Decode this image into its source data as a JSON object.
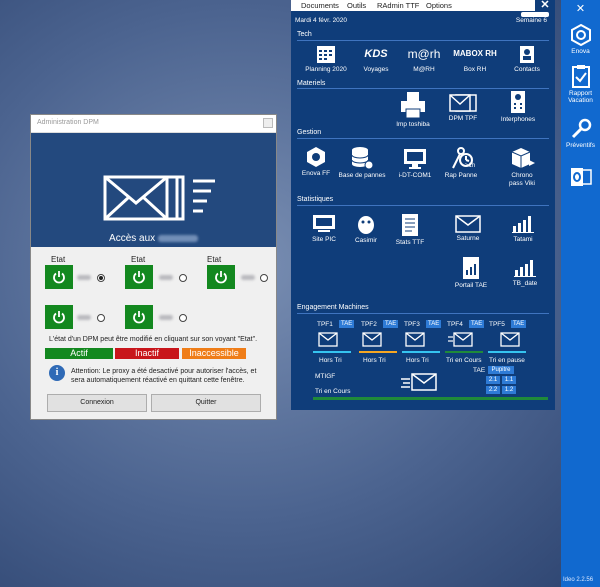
{
  "dpm": {
    "title": "Administration DPM",
    "heading_prefix": "Accès aux",
    "etat_label": "Etat",
    "state_message": "L'état d'un DPM  peut être modifié en cliquant sur son voyant \"Etat\".",
    "legend": {
      "actif": "Actif",
      "inactif": "Inactif",
      "inaccessible": "Inaccessible"
    },
    "attention": "Attention: Le proxy a été desactivé pour autoriser l'accès, et sera automatiquement réactivé en quittant cette fenêtre.",
    "buttons": {
      "connexion": "Connexion",
      "quitter": "Quitter"
    },
    "colors": {
      "actif": "#13881f",
      "inactif": "#c8151b",
      "inaccessible": "#ef7d18",
      "banner": "#23497e"
    }
  },
  "menu": {
    "documents": "Documents",
    "outils": "Outils",
    "radmin": "RAdmin TTF",
    "options": "Options",
    "close": "✕"
  },
  "header": {
    "date": "Mardi 4 févr. 2020",
    "week": "Semaine 6"
  },
  "sections": {
    "tech": "Tech",
    "materiels": "Materiels",
    "gestion": "Gestion",
    "statistiques": "Statistiques",
    "engagement": "Engagement Machines"
  },
  "tech": {
    "planning": "Planning 2020",
    "voyages": "Voyages",
    "kds_logo": "KDS",
    "marh_logo": "m@rh",
    "marh": "M@RH",
    "boxrh_logo": "MABOX RH",
    "boxrh": "Box RH",
    "contacts": "Contacts"
  },
  "materiels": {
    "imp": "Imp toshiba",
    "dpm_tpf": "DPM TPF",
    "interphones": "Interphones"
  },
  "gestion": {
    "enova": "Enova FF",
    "base": "Base de pannes",
    "idt": "i-DT-COM1",
    "rap": "Rap Panne",
    "rap_badge": ">1h",
    "chrono": "Chrono\npass Viki"
  },
  "stats": {
    "site_pic": "Site PIC",
    "casimir": "Casimir",
    "stats_ttf": "Stats TTF",
    "saturne": "Saturne",
    "tatami": "Tatami",
    "portail": "Portail TAE",
    "tb_date": "TB_date"
  },
  "engagement": {
    "tpf": [
      "TPF1",
      "TPF2",
      "TPF3",
      "TPF4",
      "TPF5"
    ],
    "tae": "TAE",
    "status": [
      "Hors Tri",
      "Hors Tri",
      "Hors Tri",
      "Tri en Cours",
      "Tri en pause"
    ],
    "mtigf": "MTIGF",
    "tri_en_cours": "Tri en Cours",
    "tae_label": "TAE",
    "pupitre": "Pupitre",
    "grid": [
      "2.1",
      "1.1",
      "2.2",
      "1.2"
    ],
    "bar_colors": [
      "#35c4f0",
      "#f5a623",
      "#35c4f0",
      "#1f8a3a",
      "#35c4f0"
    ]
  },
  "sidebar": {
    "close": "✕",
    "enova": "Enova",
    "rapport": "Rapport\nVacation",
    "preventifs": "Préventifs",
    "version": "Ideo 2.2.56"
  }
}
